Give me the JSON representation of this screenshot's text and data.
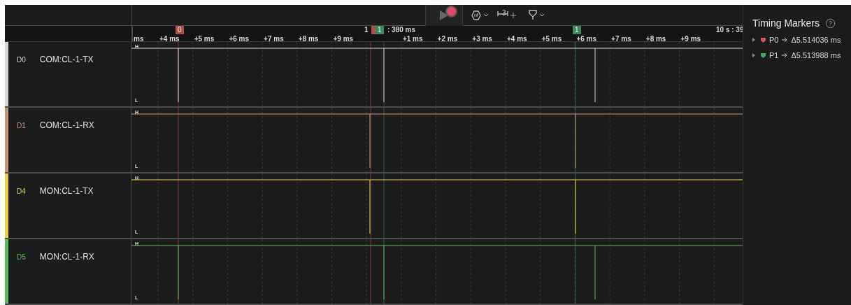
{
  "toolbar": {
    "recording": true,
    "measure_count": "3"
  },
  "ruler": {
    "left_cut": "ms",
    "minor": [
      "+4 ms",
      "+5 ms",
      "+6 ms",
      "+7 ms",
      "+8 ms",
      "+9 ms",
      "+1 ms",
      "+2 ms",
      "+3 ms",
      "+4 ms",
      "+5 ms",
      "+6 ms",
      "+7 ms",
      "+8 ms",
      "+9 ms"
    ],
    "major": [
      "1",
      ": 380 ms"
    ],
    "right_cut": "10 s : 39"
  },
  "flags": [
    {
      "label": "0",
      "color": "#b0504b"
    },
    {
      "color": "#b0504b"
    },
    {
      "label": "1",
      "color": "#3e8a60"
    },
    {
      "label": "1",
      "color": "#3e8a60"
    }
  ],
  "channels": [
    {
      "id": "D0",
      "name": "COM:CL-1-TX",
      "color": "#d6d6d6",
      "high": "H",
      "low": "L"
    },
    {
      "id": "D1",
      "name": "COM:CL-1-RX",
      "color": "#c6967c",
      "high": "H",
      "low": "L"
    },
    {
      "id": "D4",
      "name": "MON:CL-1-TX",
      "color": "#e4d44c",
      "high": "H",
      "low": "L"
    },
    {
      "id": "D5",
      "name": "MON:CL-1-RX",
      "color": "#5cb85c",
      "high": "H",
      "low": "L"
    }
  ],
  "panel": {
    "title": "Timing Markers",
    "markers": [
      {
        "name": "P0",
        "color": "#e05656",
        "delta": "Δ5.514036 ms"
      },
      {
        "name": "P1",
        "color": "#3fa86a",
        "delta": "Δ5.513988 ms"
      }
    ]
  }
}
